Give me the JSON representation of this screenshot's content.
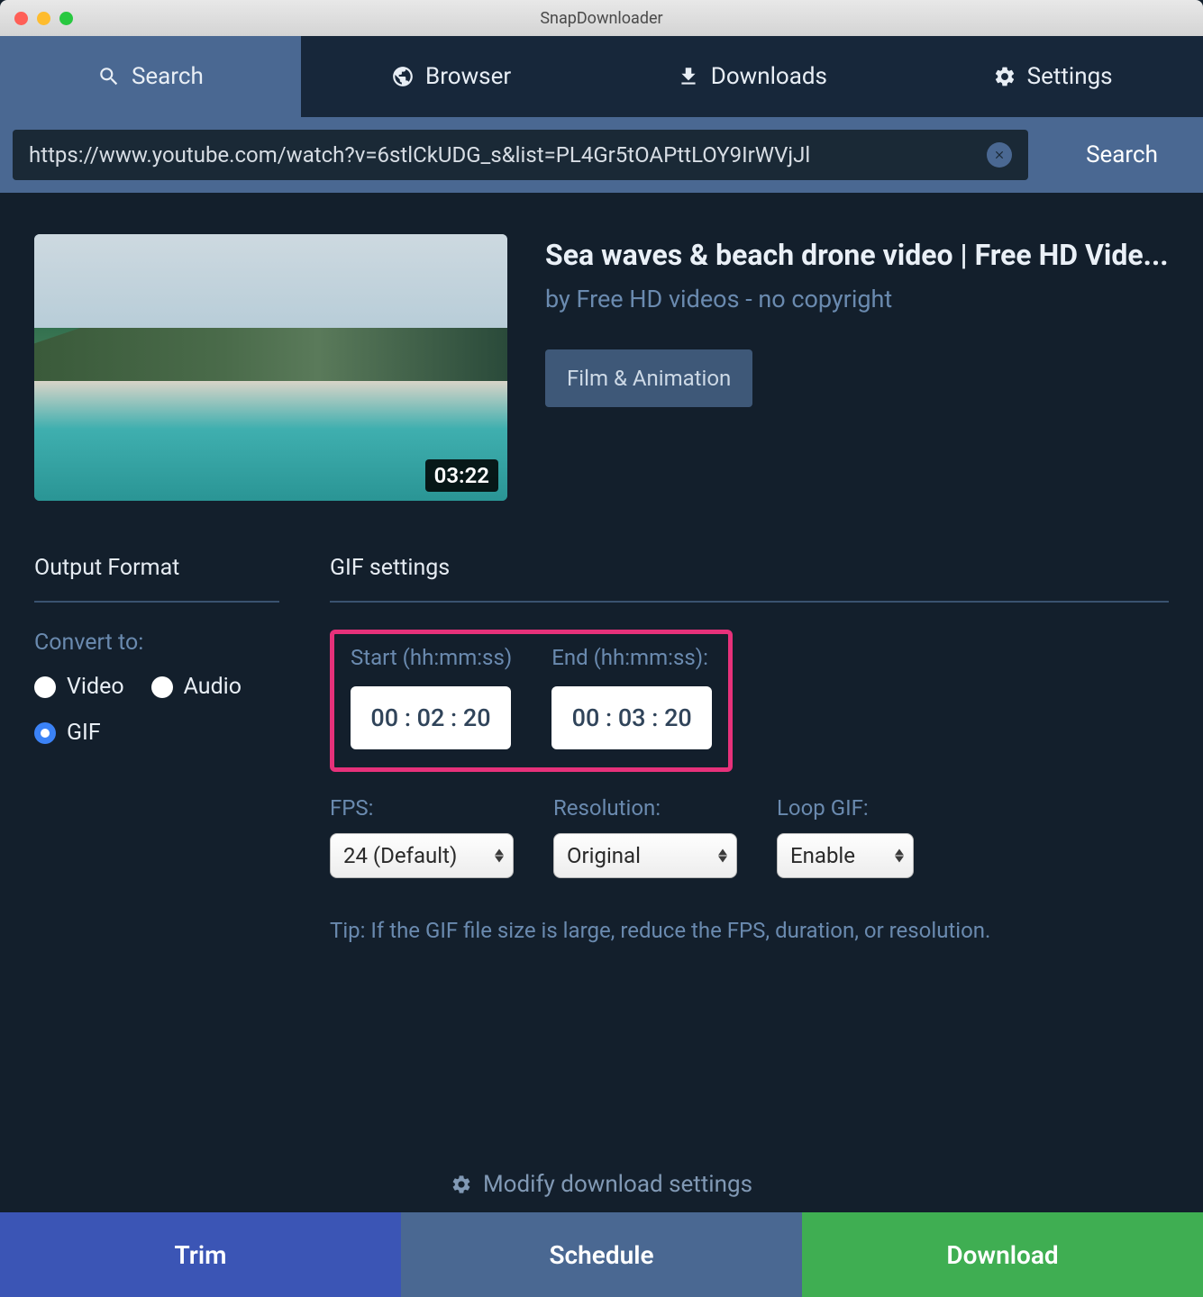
{
  "window": {
    "title": "SnapDownloader"
  },
  "tabs": [
    {
      "label": "Search",
      "icon": "search-icon"
    },
    {
      "label": "Browser",
      "icon": "globe-icon"
    },
    {
      "label": "Downloads",
      "icon": "download-icon"
    },
    {
      "label": "Settings",
      "icon": "gear-icon"
    }
  ],
  "search": {
    "value": "https://www.youtube.com/watch?v=6stlCkUDG_s&list=PL4Gr5tOAPttLOY9IrWVjJl",
    "button": "Search"
  },
  "video": {
    "title": "Sea waves & beach drone video | Free HD Vide...",
    "author": "by Free HD videos - no copyright",
    "category": "Film & Animation",
    "duration": "03:22"
  },
  "output_format": {
    "heading": "Output Format",
    "convert_label": "Convert to:",
    "options": [
      "Video",
      "Audio",
      "GIF"
    ],
    "selected": "GIF"
  },
  "gif_settings": {
    "heading": "GIF settings",
    "start_label": "Start (hh:mm:ss)",
    "end_label": "End (hh:mm:ss):",
    "start_value": "00 : 02 : 20",
    "end_value": "00 : 03 : 20",
    "fps_label": "FPS:",
    "fps_value": "24 (Default)",
    "resolution_label": "Resolution:",
    "resolution_value": "Original",
    "loop_label": "Loop GIF:",
    "loop_value": "Enable",
    "tip": "Tip: If the GIF file size is large, reduce the FPS, duration, or resolution."
  },
  "modify_link": "Modify download settings",
  "actions": {
    "trim": "Trim",
    "schedule": "Schedule",
    "download": "Download"
  }
}
